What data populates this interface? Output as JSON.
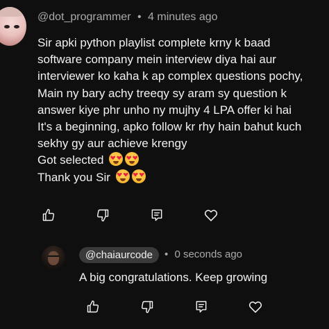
{
  "comment": {
    "author": "@dot_programmer",
    "separator": "•",
    "time": "4 minutes ago",
    "lines": [
      "Sir apki python playlist complete krny k baad",
      "software company mein interview diya hai aur",
      "interviewer ko kaha k ap complex questions pochy,",
      "Main ny bary achy treeqy sy aram sy question k",
      "answer kiye phr unho ny mujhy 4 LPA offer ki hai",
      "It's a beginning, apko follow kr rhy hain bahut kuch",
      "sekhy gy aur achieve krengy",
      "Got selected",
      "Thank you Sir"
    ],
    "emoji": "heart-eyes-emoji"
  },
  "reply": {
    "author": "@chaiaurcode",
    "separator": "•",
    "time": "0 seconds ago",
    "text": "A big congratulations. Keep growing"
  },
  "icons": {
    "like": "thumbs-up-icon",
    "dislike": "thumbs-down-icon",
    "reply": "reply-icon",
    "heart": "heart-icon"
  },
  "colors": {
    "background": "#0f0f0f",
    "text": "#f1f1f1",
    "muted": "#aaaaaa",
    "badge": "#3a3a3a"
  }
}
